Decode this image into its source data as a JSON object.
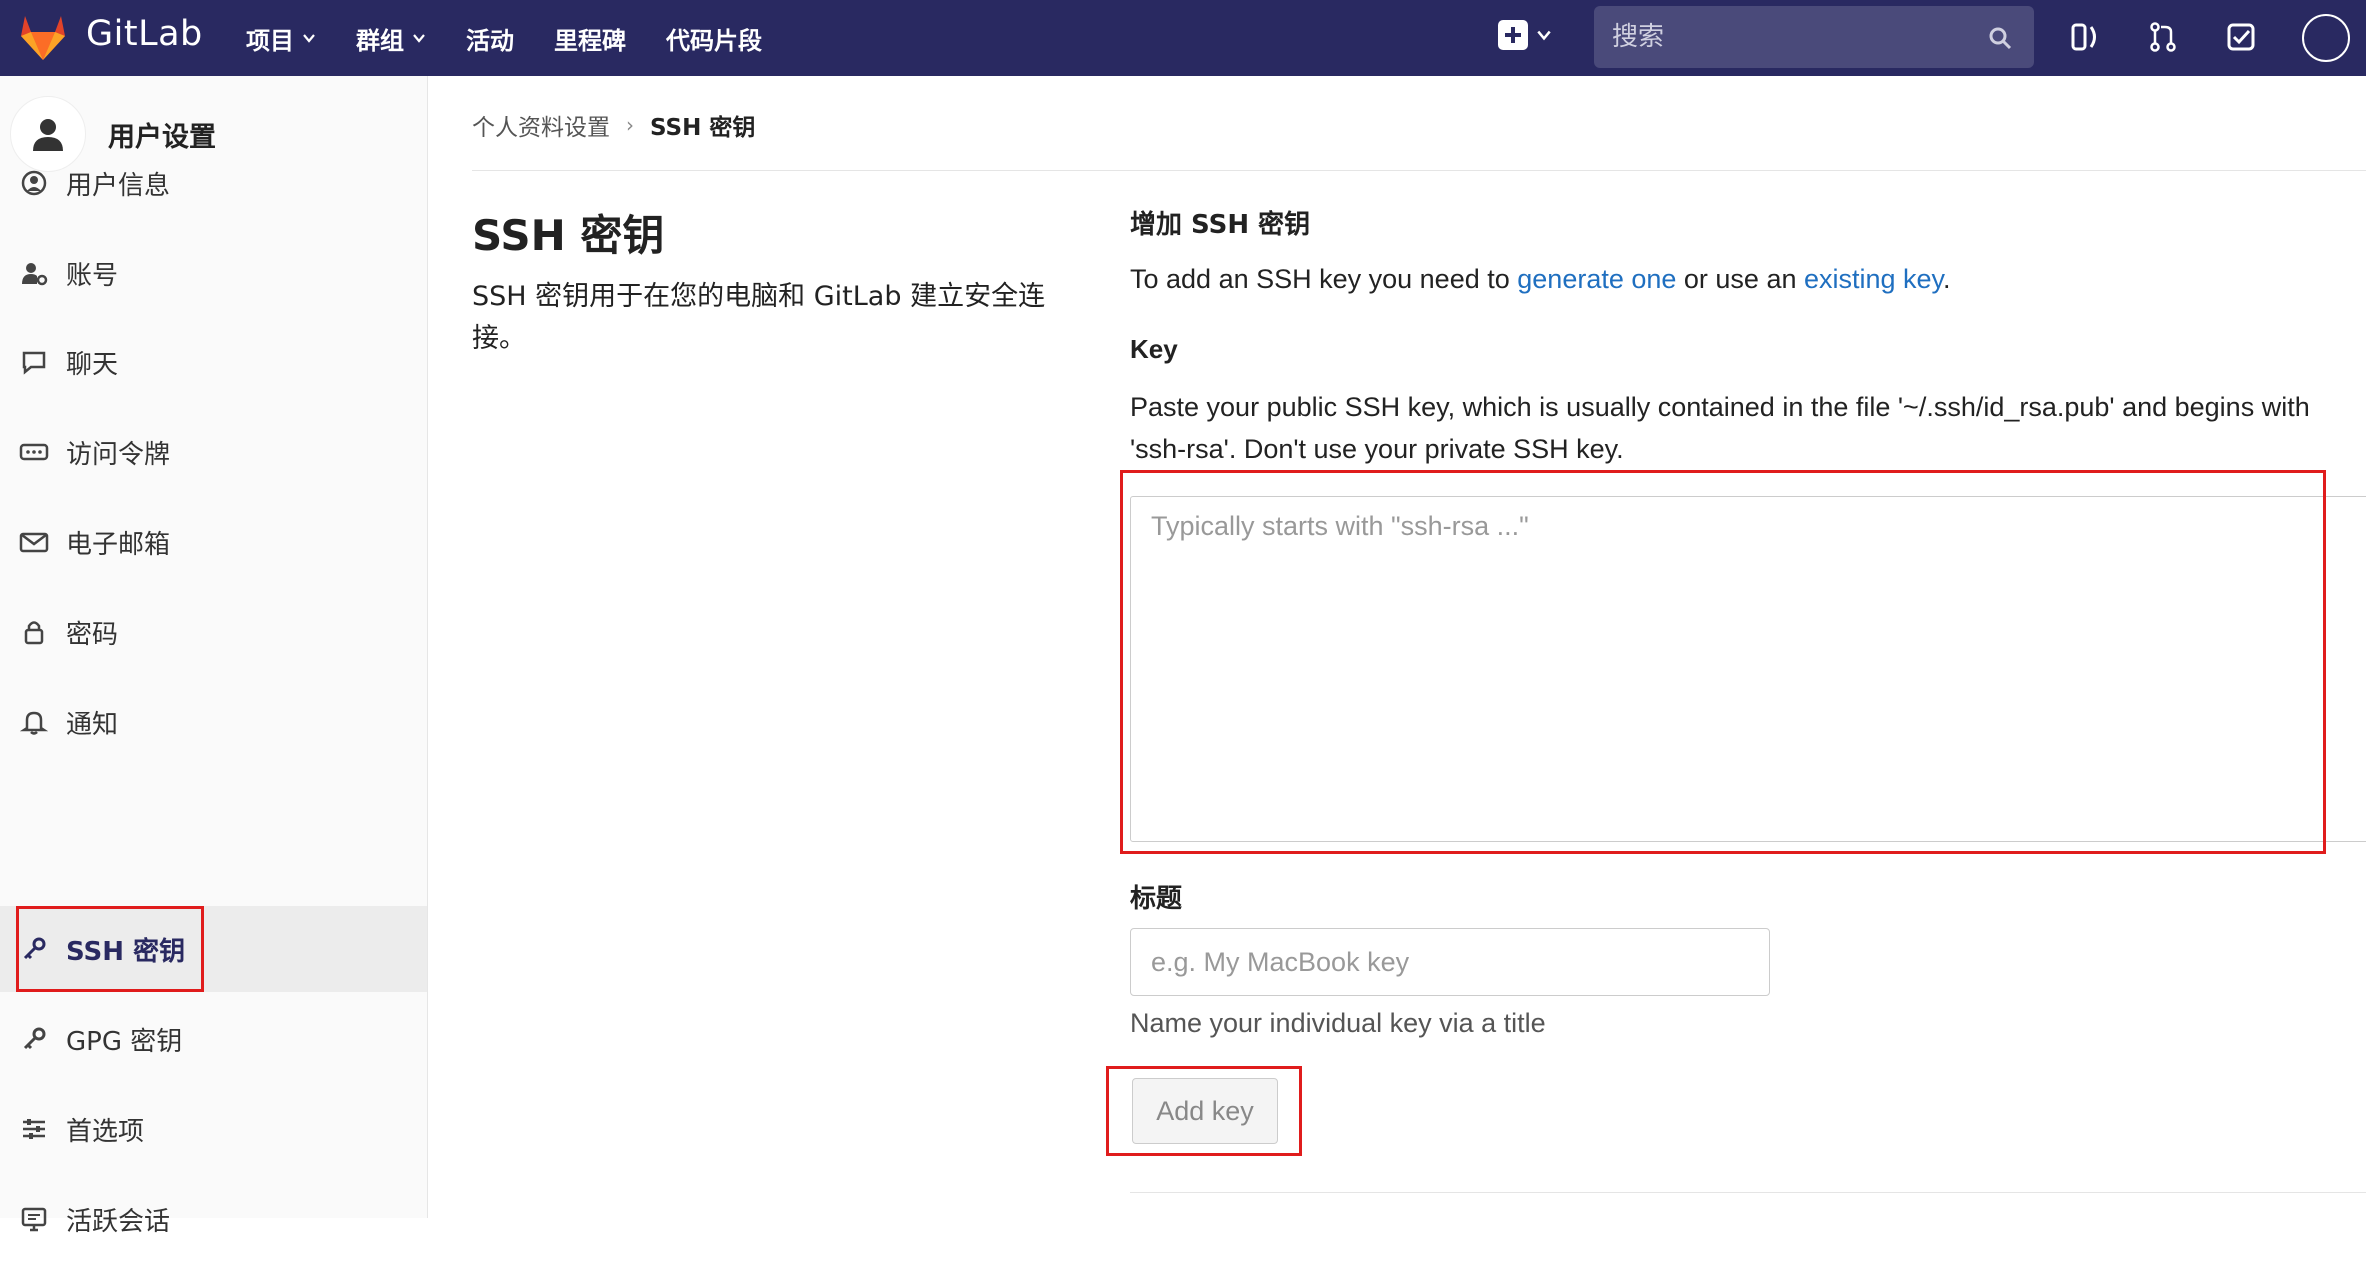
{
  "navbar": {
    "brand": "GitLab",
    "menu": [
      {
        "label": "项目",
        "has_dropdown": true
      },
      {
        "label": "群组",
        "has_dropdown": true
      },
      {
        "label": "活动",
        "has_dropdown": false
      },
      {
        "label": "里程碑",
        "has_dropdown": false
      },
      {
        "label": "代码片段",
        "has_dropdown": false
      }
    ],
    "search_placeholder": "搜索"
  },
  "sidebar": {
    "title": "用户设置",
    "items": [
      {
        "label": "用户信息",
        "icon": "user-circle-icon"
      },
      {
        "label": "账号",
        "icon": "user-gear-icon"
      },
      {
        "label": "聊天",
        "icon": "chat-icon"
      },
      {
        "label": "访问令牌",
        "icon": "token-icon"
      },
      {
        "label": "电子邮箱",
        "icon": "mail-icon"
      },
      {
        "label": "密码",
        "icon": "lock-icon"
      },
      {
        "label": "通知",
        "icon": "bell-icon"
      },
      {
        "label": "SSH 密钥",
        "icon": "key-icon",
        "active": true
      },
      {
        "label": "GPG 密钥",
        "icon": "key-icon"
      },
      {
        "label": "首选项",
        "icon": "sliders-icon"
      },
      {
        "label": "活跃会话",
        "icon": "monitor-icon"
      }
    ]
  },
  "breadcrumb": {
    "parent": "个人资料设置",
    "current": "SSH 密钥"
  },
  "main": {
    "title": "SSH 密钥",
    "description": "SSH 密钥用于在您的电脑和 GitLab 建立安全连接。",
    "section_title": "增加 SSH 密钥",
    "intro": {
      "prefix": "To add an SSH key you need to ",
      "link1": "generate one",
      "middle": " or use an ",
      "link2": "existing key",
      "suffix": "."
    },
    "key_label": "Key",
    "key_help": "Paste your public SSH key, which is usually contained in the file '~/.ssh/id_rsa.pub' and begins with 'ssh-rsa'. Don't use your private SSH key.",
    "key_placeholder": "Typically starts with \"ssh-rsa ...\"",
    "title_label": "标题",
    "title_placeholder": "e.g. My MacBook key",
    "title_help": "Name your individual key via a title",
    "add_button": "Add key"
  },
  "colors": {
    "navbar_bg": "#292961",
    "link": "#1f6fc0",
    "highlight_box": "#e01c1c"
  }
}
